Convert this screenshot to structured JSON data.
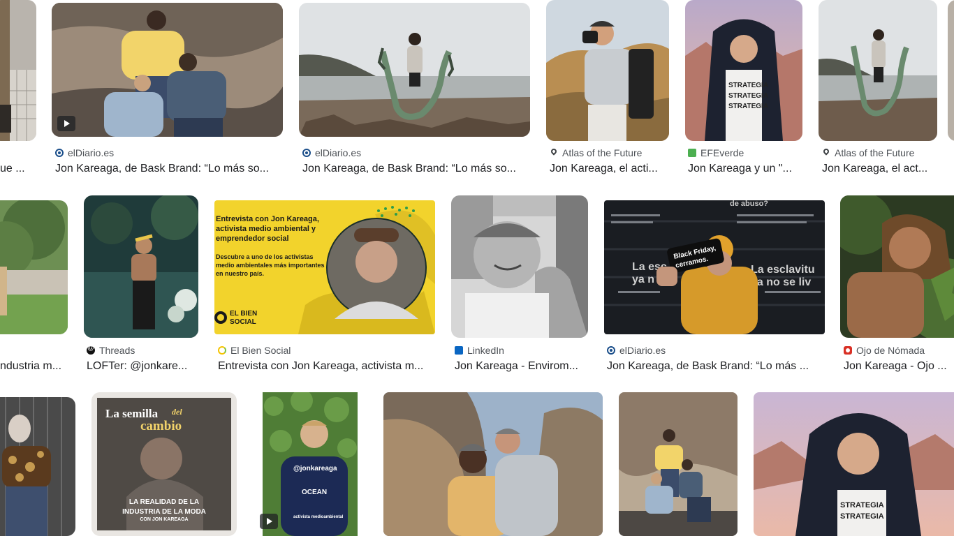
{
  "results": [
    {
      "source": "",
      "title": "ue ..."
    },
    {
      "source": "elDiario.es",
      "title": "Jon Kareaga, de Bask Brand: “Lo más so..."
    },
    {
      "source": "elDiario.es",
      "title": "Jon Kareaga, de Bask Brand: “Lo más so..."
    },
    {
      "source": "Atlas of the Future",
      "title": "Jon Kareaga, el acti..."
    },
    {
      "source": "EFEverde",
      "title": "Jon Kareaga y un \"..."
    },
    {
      "source": "Atlas of the Future",
      "title": "Jon Kareaga, el act..."
    },
    {
      "source": "",
      "title": "ndustria m..."
    },
    {
      "source": "Threads",
      "title": "LOFTer: @jonkare..."
    },
    {
      "source": "El Bien Social",
      "title": "Entrevista con Jon Kareaga, activista m..."
    },
    {
      "source": "LinkedIn",
      "title": "Jon Kareaga - Envirom..."
    },
    {
      "source": "elDiario.es",
      "title": "Jon Kareaga, de Bask Brand: “Lo más ..."
    },
    {
      "source": "Ojo de Nómada",
      "title": "Jon Kareaga - Ojo ..."
    }
  ],
  "image_text": {
    "ebs_lines": [
      "Entrevista con Jon Kareaga,",
      "activista medio ambiental y",
      "emprendedor social"
    ],
    "ebs_sub": [
      "Descubre a uno de los activistas",
      "medio ambientales más importantes",
      "en nuestro país."
    ],
    "ebs_logo": [
      "EL BIEN",
      "SOCIAL"
    ],
    "phone_text": [
      "Black Friday,",
      "cerramos."
    ],
    "wall_text": [
      "La esc",
      "ya n",
      "La esclavitu",
      "ya no se liv"
    ],
    "wall_top": "de abuso?",
    "semilla_1": "La semilla",
    "semilla_2": "del",
    "semilla_3": "cambio",
    "semilla_bottom": [
      "LA REALIDAD DE LA",
      "INDUSTRIA DE LA MODA",
      "CON JON KAREAGA"
    ],
    "shirt_handle": "@jonkareaga",
    "shirt_brand": "OCEAN",
    "shirt_caption": "activista medioambiental",
    "hoodie_text": [
      "STRATEGIA",
      "STRATEGIA",
      "STRATEGIA"
    ]
  },
  "colors": {
    "source_text": "#4d5156",
    "title_text": "#202124",
    "ebs_yellow": "#f2d32c",
    "eldiario_blue": "#1a4e8a"
  }
}
